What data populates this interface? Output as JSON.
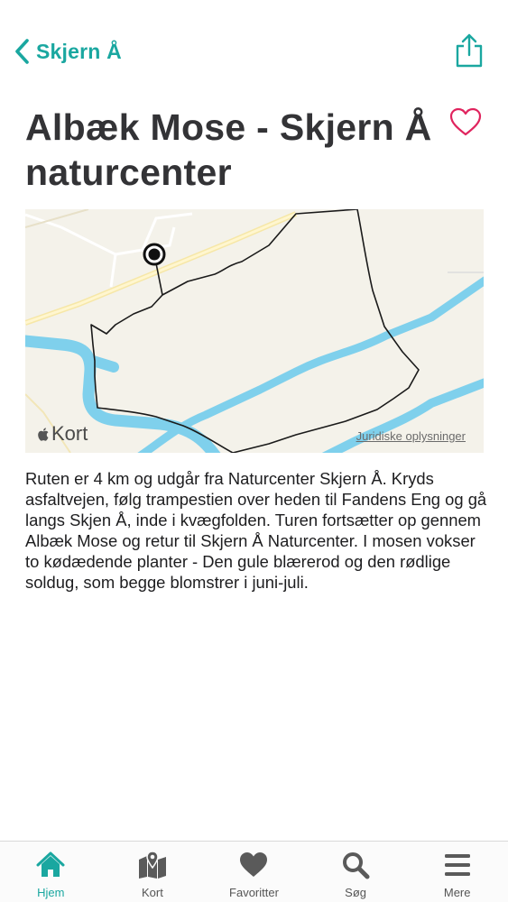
{
  "nav": {
    "back_label": "Skjern Å"
  },
  "page": {
    "title": "Albæk Mose - Skjern Å naturcenter",
    "description": "Ruten er 4 km og udgår fra Naturcenter Skjern Å. Kryds asfaltvejen, følg trampestien over heden til Fandens Eng og gå langs Skjen Å, inde i kvægfolden. Turen fortsætter op gennem Albæk Mose og retur til Skjern Å Naturcenter. I mosen vokser to kødædende planter - Den gule blærerod og den rødlige soldug, som begge blomstrer i juni-juli."
  },
  "map": {
    "logo_label": "Kort",
    "legal_label": "Juridiske oplysninger"
  },
  "tabs": [
    {
      "label": "Hjem",
      "icon": "home-icon",
      "active": true
    },
    {
      "label": "Kort",
      "icon": "map-icon",
      "active": false
    },
    {
      "label": "Favoritter",
      "icon": "heart-icon",
      "active": false
    },
    {
      "label": "Søg",
      "icon": "search-icon",
      "active": false
    },
    {
      "label": "Mere",
      "icon": "menu-icon",
      "active": false
    }
  ],
  "colors": {
    "accent": "#1aa7a0",
    "favorite": "#e0245e",
    "water": "#7fd0ec",
    "route": "#1a1a1a"
  }
}
